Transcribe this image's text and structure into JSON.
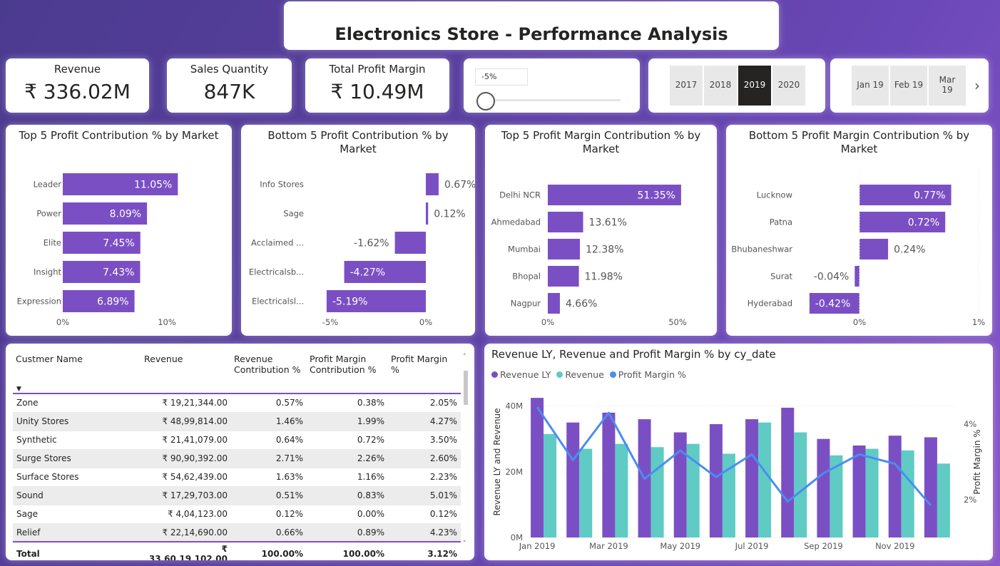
{
  "title": "Electronics Store - Performance Analysis",
  "kpis": {
    "revenue": {
      "label": "Revenue",
      "value": "₹ 336.02M"
    },
    "sales_qty": {
      "label": "Sales Quantity",
      "value": "847K"
    },
    "profit_margin": {
      "label": "Total Profit Margin",
      "value": "₹ 10.49M"
    }
  },
  "slider": {
    "value_text": "-5%"
  },
  "years": {
    "items": [
      "2017",
      "2018",
      "2019",
      "2020"
    ],
    "selected": "2019"
  },
  "months": {
    "items": [
      "Jan 19",
      "Feb 19",
      "Mar 19"
    ],
    "next_icon": "chevron-right-icon"
  },
  "colors": {
    "purple": "#7b4fc4",
    "teal": "#5fcbc4",
    "blue": "#4a8df0"
  },
  "chart_data": [
    {
      "type": "bar",
      "title": "Top 5 Profit Contribution % by Market",
      "categories": [
        "Leader",
        "Power",
        "Elite",
        "Insight",
        "Expression"
      ],
      "values": [
        11.05,
        8.09,
        7.45,
        7.43,
        6.89
      ],
      "labels": [
        "11.05%",
        "8.09%",
        "7.45%",
        "7.43%",
        "6.89%"
      ],
      "ticks": [
        "0%",
        "10%"
      ],
      "xlim": [
        0,
        10
      ]
    },
    {
      "type": "bar",
      "title": "Bottom 5 Profit Contribution % by Market",
      "categories": [
        "Info Stores",
        "Sage",
        "Acclaimed ...",
        "Electricalsb...",
        "Electricalsl..."
      ],
      "values": [
        0.67,
        0.12,
        -1.62,
        -4.27,
        -5.19
      ],
      "labels": [
        "0.67%",
        "0.12%",
        "-1.62%",
        "-4.27%",
        "-5.19%"
      ],
      "ticks": [
        "-5%",
        "0%"
      ],
      "xlim": [
        -5,
        0
      ]
    },
    {
      "type": "bar",
      "title": "Top 5 Profit Margin Contribution % by Market",
      "categories": [
        "Delhi NCR",
        "Ahmedabad",
        "Mumbai",
        "Bhopal",
        "Nagpur"
      ],
      "values": [
        51.35,
        13.61,
        12.38,
        11.98,
        4.66
      ],
      "labels": [
        "51.35%",
        "13.61%",
        "12.38%",
        "11.98%",
        "4.66%"
      ],
      "ticks": [
        "0%",
        "50%"
      ],
      "xlim": [
        0,
        50
      ]
    },
    {
      "type": "bar",
      "title": "Bottom 5 Profit Margin Contribution % by Market",
      "categories": [
        "Lucknow",
        "Patna",
        "Bhubaneshwar",
        "Surat",
        "Hyderabad"
      ],
      "values": [
        0.77,
        0.72,
        0.24,
        -0.04,
        -0.42
      ],
      "labels": [
        "0.77%",
        "0.72%",
        "0.24%",
        "-0.04%",
        "-0.42%"
      ],
      "ticks": [
        "0%",
        "1%"
      ],
      "xlim": [
        0,
        1
      ]
    },
    {
      "type": "bar",
      "title": "Revenue LY, Revenue and Profit Margin % by cy_date",
      "legend": [
        "Revenue LY",
        "Revenue",
        "Profit Margin %"
      ],
      "categories": [
        "Jan 2019",
        "Feb 2019",
        "Mar 2019",
        "Apr 2019",
        "May 2019",
        "Jun 2019",
        "Jul 2019",
        "Aug 2019",
        "Sep 2019",
        "Oct 2019",
        "Nov 2019",
        "Dec 2019"
      ],
      "x_tick_labels": [
        "Jan 2019",
        "Mar 2019",
        "May 2019",
        "Jul 2019",
        "Sep 2019",
        "Nov 2019"
      ],
      "series": [
        {
          "name": "Revenue LY",
          "values": [
            42.5,
            35,
            38,
            36,
            32,
            34.5,
            36,
            39.5,
            30,
            28,
            31,
            30.5
          ]
        },
        {
          "name": "Revenue",
          "values": [
            31.5,
            27,
            28.5,
            27.5,
            28.5,
            25.5,
            35,
            32,
            25,
            27,
            26.5,
            22.5
          ]
        },
        {
          "name": "Profit Margin %",
          "values": [
            4.45,
            3.05,
            4.3,
            2.55,
            3.3,
            2.6,
            3.2,
            1.95,
            2.7,
            3.2,
            2.95,
            1.85
          ]
        }
      ],
      "ylabel": "Revenue LY and Revenue",
      "y2label": "Profit Margin %",
      "y_ticks": [
        "0M",
        "20M",
        "40M"
      ],
      "y2_ticks": [
        "2%",
        "4%"
      ],
      "ylim": [
        0,
        46
      ],
      "y2lim": [
        1,
        5
      ]
    }
  ],
  "table": {
    "headers": [
      "Custmer Name",
      "Revenue",
      "Revenue Contribution %",
      "Profit Margin Contribution %",
      "Profit Margin %"
    ],
    "sort_icon": "sort-desc-icon",
    "rows": [
      [
        "Zone",
        "₹ 19,21,344.00",
        "0.57%",
        "0.38%",
        "2.05%"
      ],
      [
        "Unity Stores",
        "₹ 48,99,814.00",
        "1.46%",
        "1.99%",
        "4.27%"
      ],
      [
        "Synthetic",
        "₹ 21,41,079.00",
        "0.64%",
        "0.72%",
        "3.50%"
      ],
      [
        "Surge Stores",
        "₹ 90,90,392.00",
        "2.71%",
        "2.26%",
        "2.60%"
      ],
      [
        "Surface Stores",
        "₹ 54,62,439.00",
        "1.63%",
        "1.16%",
        "2.23%"
      ],
      [
        "Sound",
        "₹ 17,29,703.00",
        "0.51%",
        "0.83%",
        "5.01%"
      ],
      [
        "Sage",
        "₹ 4,04,123.00",
        "0.12%",
        "0.00%",
        "0.12%"
      ],
      [
        "Relief",
        "₹ 22,14,690.00",
        "0.66%",
        "0.89%",
        "4.23%"
      ]
    ],
    "total": [
      "Total",
      "₹ 33,60,19,102.00",
      "100.00%",
      "100.00%",
      "3.12%"
    ]
  }
}
